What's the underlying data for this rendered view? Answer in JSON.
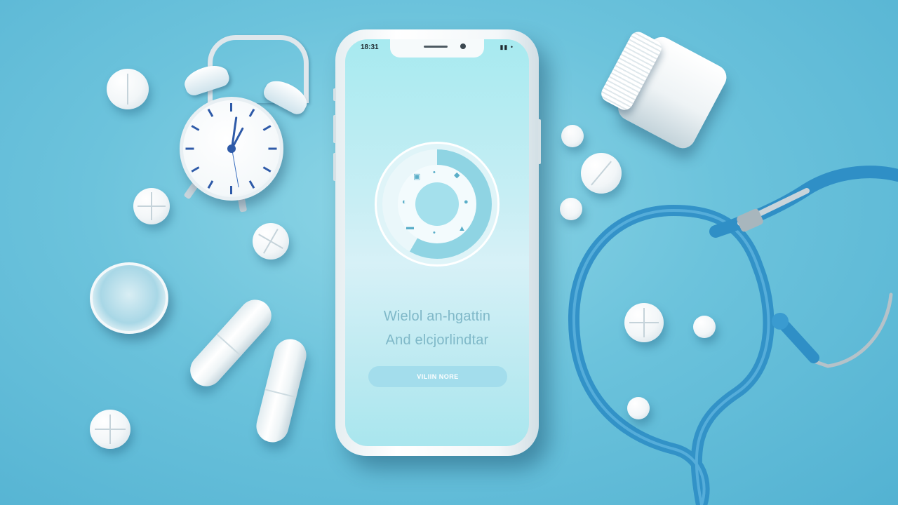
{
  "scene": {
    "background_color": "#6cc3dc",
    "accent_color": "#2e8fc0"
  },
  "phone": {
    "status_bar": {
      "time": "18:31",
      "icons": "▮▮ •"
    },
    "hero": {
      "icon_names": [
        "pill-icon",
        "syringe-icon",
        "heart-icon",
        "bottle-icon",
        "capsule-icon",
        "bandage-icon",
        "thermometer-icon",
        "drop-icon"
      ]
    },
    "headline_line1": "Wielol an-hgattin",
    "headline_line2": "And elcjorlindtar",
    "cta_label": "VILIIN NORE"
  }
}
